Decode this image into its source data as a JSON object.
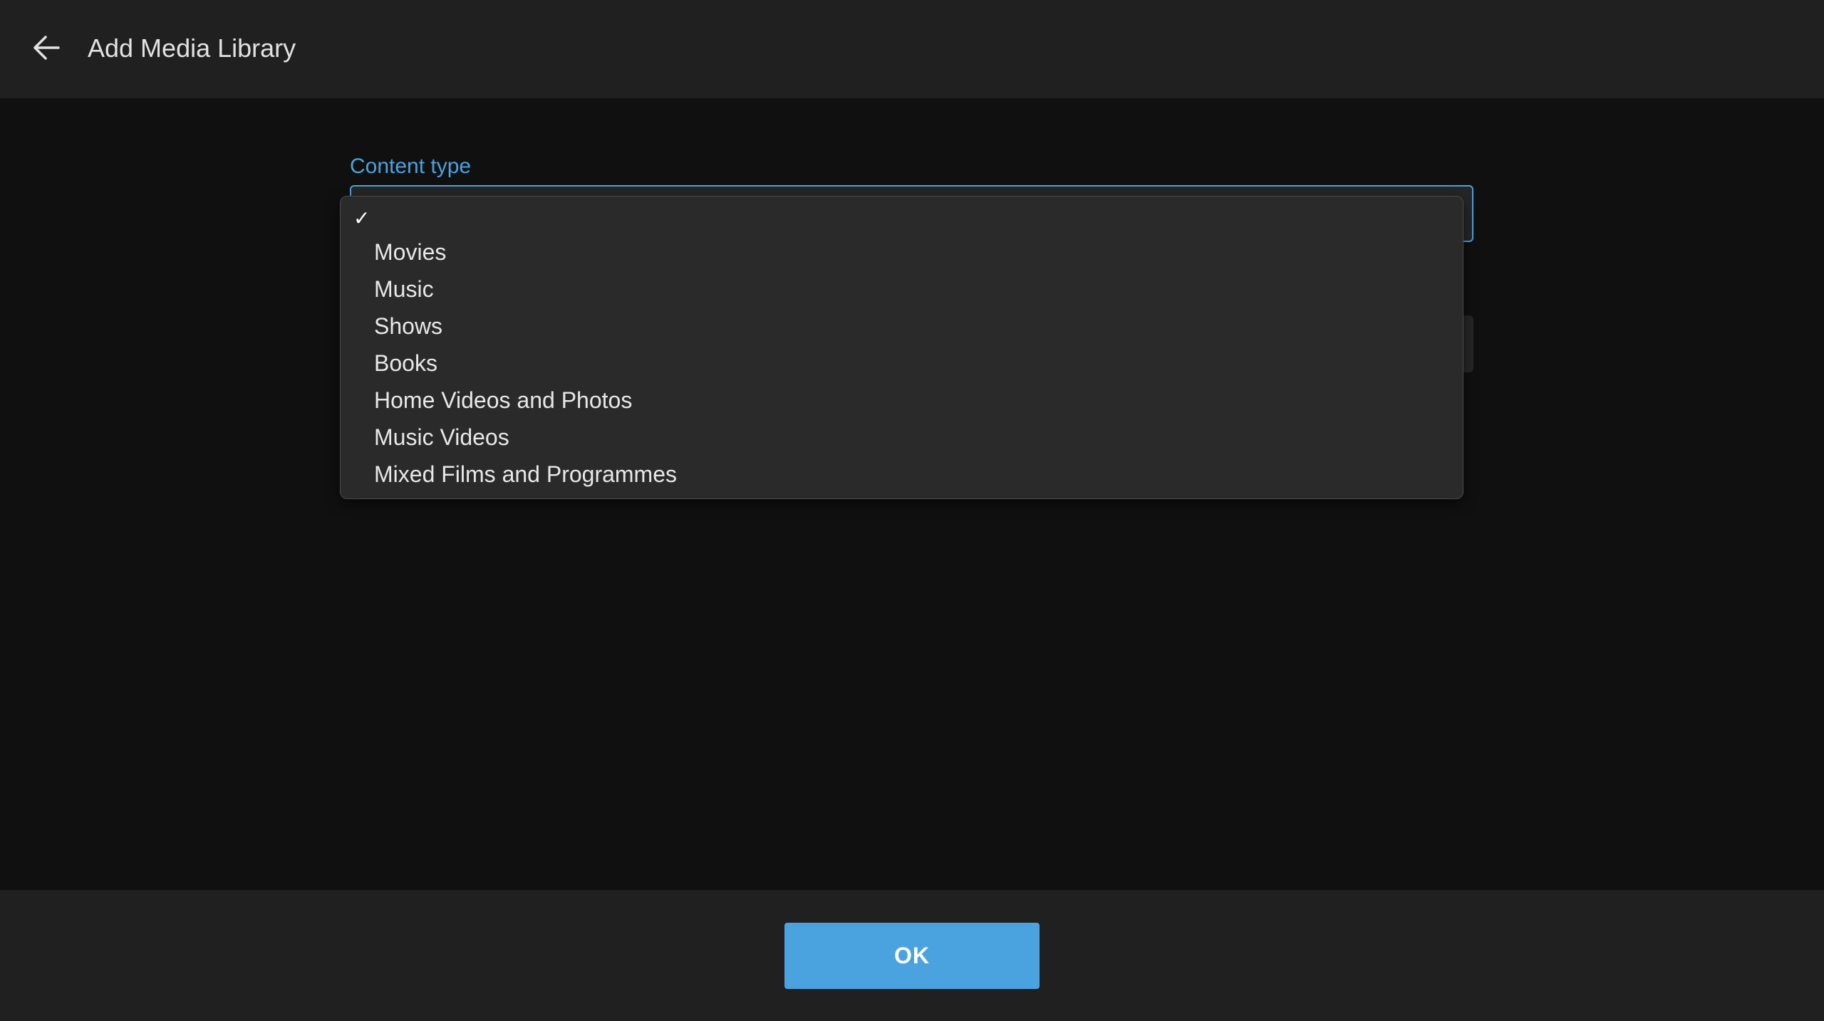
{
  "header": {
    "back_icon": "arrow-left-icon",
    "title": "Add Media Library"
  },
  "form": {
    "content_type_label": "Content type",
    "content_type_value": ""
  },
  "dropdown": {
    "selected_index": 0,
    "check_mark": "✓",
    "options": [
      {
        "label": ""
      },
      {
        "label": "Movies"
      },
      {
        "label": "Music"
      },
      {
        "label": "Shows"
      },
      {
        "label": "Books"
      },
      {
        "label": "Home Videos and Photos"
      },
      {
        "label": "Music Videos"
      },
      {
        "label": "Mixed Films and Programmes"
      }
    ]
  },
  "footer": {
    "ok_label": "OK"
  },
  "colors": {
    "accent": "#4aa3df",
    "header_bg": "#202020",
    "page_bg": "#101010",
    "dropdown_bg": "#2a2a2a"
  }
}
